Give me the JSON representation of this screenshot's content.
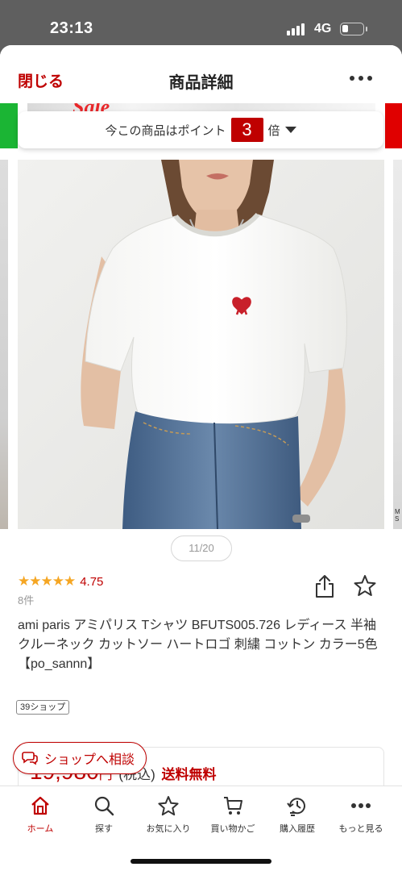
{
  "status_bar": {
    "time": "23:13",
    "network": "4G"
  },
  "header": {
    "close_label": "閉じる",
    "title": "商品詳細",
    "more_icon": "more-dots-icon"
  },
  "banner": {
    "text": "Sale"
  },
  "points": {
    "prefix": "今この商品はポイント",
    "multiplier": "3",
    "suffix": "倍"
  },
  "gallery": {
    "counter": "11/20",
    "next_peek_text": "M\nS"
  },
  "rating": {
    "stars": "★★★★★",
    "score": "4.75",
    "review_count": "8件"
  },
  "product": {
    "title": "ami paris アミパリス Tシャツ BFUTS005.726 レディース 半袖 クルーネック カットソー ハートロゴ 刺繍 コットン カラー5色【po_sannn】",
    "shop_tag": "39ショップ"
  },
  "price": {
    "amount": "19,980",
    "yen": "円",
    "tax": "(税込)",
    "shipping": "送料無料"
  },
  "consult": {
    "label": "ショップへ相談"
  },
  "tabbar": {
    "items": [
      {
        "label": "ホーム",
        "icon": "home-icon",
        "active": true
      },
      {
        "label": "探す",
        "icon": "search-icon",
        "active": false
      },
      {
        "label": "お気に入り",
        "icon": "star-icon",
        "active": false
      },
      {
        "label": "買い物かご",
        "icon": "cart-icon",
        "active": false
      },
      {
        "label": "購入履歴",
        "icon": "history-icon",
        "active": false
      },
      {
        "label": "もっと見る",
        "icon": "more-dots-icon",
        "active": false
      }
    ]
  },
  "colors": {
    "accent": "#bf0000",
    "star": "#f5a623"
  }
}
